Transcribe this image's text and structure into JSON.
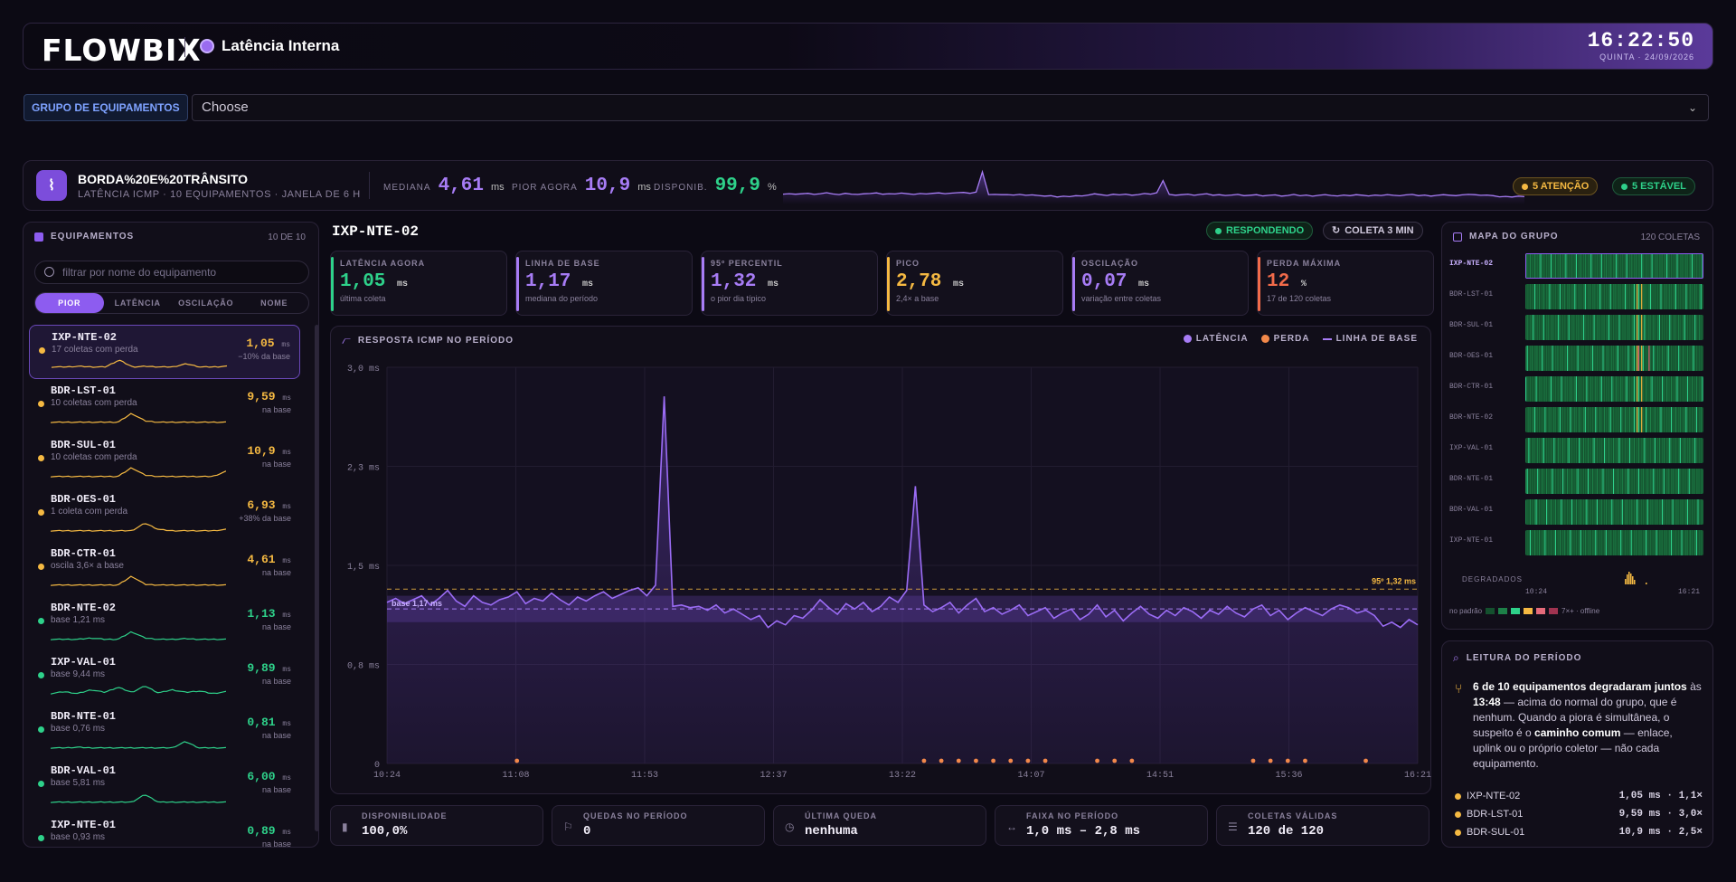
{
  "app": {
    "logo": "FLOWBIX",
    "title": "Latência Interna",
    "time": "16:22:50",
    "date": "QUINTA · 24/09/2026"
  },
  "group": {
    "label": "GRUPO DE EQUIPAMENTOS",
    "value": "Choose"
  },
  "summary": {
    "name": "BORDA%20E%20TRÂNSITO",
    "subtitle": "LATÊNCIA ICMP · 10 EQUIPAMENTOS · JANELA DE 6 H",
    "median_label": "MEDIANA",
    "median_value": "4,61",
    "median_unit": "ms",
    "worst_label": "PIOR AGORA",
    "worst_value": "10,9",
    "worst_unit": "ms",
    "avail_label": "DISPONIB.",
    "avail_value": "99,9",
    "avail_unit": "%",
    "attention_pill": "5 ATENÇÃO",
    "stable_pill": "5 ESTÁVEL"
  },
  "equipment": {
    "title": "EQUIPAMENTOS",
    "count": "10 DE 10",
    "search_placeholder": "filtrar por nome do equipamento",
    "sorts": [
      "PIOR",
      "LATÊNCIA",
      "OSCILAÇÃO",
      "NOME"
    ],
    "items": [
      {
        "name": "IXP-NTE-02",
        "sub": "17 coletas com perda",
        "value": "1,05",
        "note": "−10% da base",
        "status": "attention",
        "selected": true
      },
      {
        "name": "BDR-LST-01",
        "sub": "10 coletas com perda",
        "value": "9,59",
        "note": "na base",
        "status": "attention"
      },
      {
        "name": "BDR-SUL-01",
        "sub": "10 coletas com perda",
        "value": "10,9",
        "note": "na base",
        "status": "attention"
      },
      {
        "name": "BDR-OES-01",
        "sub": "1 coleta com perda",
        "value": "6,93",
        "note": "+38% da base",
        "status": "attention"
      },
      {
        "name": "BDR-CTR-01",
        "sub": "oscila 3,6× a base",
        "value": "4,61",
        "note": "na base",
        "status": "attention"
      },
      {
        "name": "BDR-NTE-02",
        "sub": "base 1,21 ms",
        "value": "1,13",
        "note": "na base",
        "status": "stable"
      },
      {
        "name": "IXP-VAL-01",
        "sub": "base 9,44 ms",
        "value": "9,89",
        "note": "na base",
        "status": "stable"
      },
      {
        "name": "BDR-NTE-01",
        "sub": "base 0,76 ms",
        "value": "0,81",
        "note": "na base",
        "status": "stable"
      },
      {
        "name": "BDR-VAL-01",
        "sub": "base 5,81 ms",
        "value": "6,00",
        "note": "na base",
        "status": "stable"
      },
      {
        "name": "IXP-NTE-01",
        "sub": "base 0,93 ms",
        "value": "0,89",
        "note": "na base",
        "status": "stable"
      }
    ],
    "unit": "ms"
  },
  "device": {
    "name": "IXP-NTE-02",
    "status_badge": "RESPONDENDO",
    "interval_badge": "COLETA 3 MIN",
    "cards": [
      {
        "label": "LATÊNCIA AGORA",
        "value": "1,05",
        "unit": "ms",
        "sub": "última coleta",
        "color": "#2ed18a"
      },
      {
        "label": "LINHA DE BASE",
        "value": "1,17",
        "unit": "ms",
        "sub": "mediana do período",
        "color": "#a77cf5"
      },
      {
        "label": "95º PERCENTIL",
        "value": "1,32",
        "unit": "ms",
        "sub": "o pior dia típico",
        "color": "#a77cf5"
      },
      {
        "label": "PICO",
        "value": "2,78",
        "unit": "ms",
        "sub": "2,4× a base",
        "color": "#f5b942"
      },
      {
        "label": "OSCILAÇÃO",
        "value": "0,07",
        "unit": "ms",
        "sub": "variação entre coletas",
        "color": "#a77cf5"
      },
      {
        "label": "PERDA MÁXIMA",
        "value": "12",
        "unit": "%",
        "sub": "17 de 120 coletas",
        "color": "#f26b4a"
      }
    ]
  },
  "chart_data": {
    "type": "line",
    "title": "RESPOSTA ICMP NO PERÍODO",
    "legend": [
      "LATÊNCIA",
      "PERDA",
      "LINHA DE BASE"
    ],
    "y_ticks": [
      "3,0 ms",
      "2,3 ms",
      "1,5 ms",
      "0,8 ms",
      "0"
    ],
    "ylim": [
      0,
      3.0
    ],
    "x_ticks": [
      "10:24",
      "11:08",
      "11:53",
      "12:37",
      "13:22",
      "14:07",
      "14:51",
      "15:36",
      "16:21"
    ],
    "baseline": 1.17,
    "baseline_label": "base 1,17 ms",
    "p95": 1.32,
    "p95_label": "95º 1,32 ms",
    "series": [
      {
        "name": "LATÊNCIA",
        "values": [
          1.22,
          1.25,
          1.21,
          1.24,
          1.27,
          1.2,
          1.25,
          1.31,
          1.23,
          1.19,
          1.27,
          1.22,
          1.2,
          1.24,
          1.26,
          1.3,
          1.21,
          1.25,
          1.23,
          1.29,
          1.24,
          1.2,
          1.26,
          1.23,
          1.27,
          1.3,
          1.25,
          1.28,
          1.31,
          1.33,
          1.27,
          1.35,
          2.78,
          1.19,
          1.2,
          1.18,
          1.19,
          1.16,
          1.2,
          1.14,
          1.17,
          1.13,
          1.09,
          1.12,
          1.03,
          1.08,
          1.05,
          1.12,
          1.1,
          1.16,
          1.24,
          1.18,
          1.13,
          1.21,
          1.17,
          1.22,
          1.15,
          1.19,
          1.26,
          1.22,
          1.31,
          2.1,
          1.2,
          1.15,
          1.18,
          1.22,
          1.14,
          1.2,
          1.25,
          1.15,
          1.18,
          1.13,
          1.16,
          1.2,
          1.12,
          1.15,
          1.18,
          1.1,
          1.14,
          1.17,
          1.09,
          1.13,
          1.2,
          1.11,
          1.16,
          1.08,
          1.14,
          1.19,
          1.13,
          1.1,
          1.16,
          1.12,
          1.18,
          1.15,
          1.1,
          1.16,
          1.13,
          1.19,
          1.14,
          1.11,
          1.17,
          1.2,
          1.12,
          1.16,
          1.09,
          1.14,
          1.18,
          1.15,
          1.12,
          1.17,
          1.2,
          1.18,
          1.14,
          1.16,
          1.12,
          1.04,
          1.07,
          1.03,
          1.09,
          1.05
        ]
      }
    ],
    "loss_points": [
      15,
      62,
      64,
      66,
      68,
      70,
      72,
      74,
      76,
      82,
      84,
      86,
      100,
      102,
      104,
      106,
      113
    ]
  },
  "stats": [
    {
      "label": "DISPONIBILIDADE",
      "value": "100,0%"
    },
    {
      "label": "QUEDAS NO PERÍODO",
      "value": "0"
    },
    {
      "label": "ÚLTIMA QUEDA",
      "value": "nenhuma"
    },
    {
      "label": "FAIXA NO PERÍODO",
      "value": "1,0 ms – 2,8 ms"
    },
    {
      "label": "COLETAS VÁLIDAS",
      "value": "120 de 120"
    }
  ],
  "map": {
    "title": "MAPA DO GRUPO",
    "count": "120 COLETAS",
    "rows": [
      "IXP-NTE-02",
      "BDR-LST-01",
      "BDR-SUL-01",
      "BDR-OES-01",
      "BDR-CTR-01",
      "BDR-NTE-02",
      "IXP-VAL-01",
      "BDR-NTE-01",
      "BDR-VAL-01",
      "IXP-NTE-01"
    ],
    "degraded_label": "DEGRADADOS",
    "start": "10:24",
    "end": "16:21",
    "legend_left": "no padrão",
    "legend_right": "7×+ · offline"
  },
  "reading": {
    "title": "LEITURA DO PERÍODO",
    "p1": "6 de 10 equipamentos degradaram juntos",
    "p2": " às ",
    "p3": "13:48",
    "p4": " — acima do normal do grupo, que é nenhum. Quando a piora é simultânea, o suspeito é o ",
    "p5": "caminho comum",
    "p6": " — enlace, uplink ou o próprio coletor — não cada equipamento.",
    "items": [
      {
        "name": "IXP-NTE-02",
        "value": "1,05 ms · 1,1×"
      },
      {
        "name": "BDR-LST-01",
        "value": "9,59 ms · 3,0×"
      },
      {
        "name": "BDR-SUL-01",
        "value": "10,9 ms · 2,5×"
      }
    ]
  },
  "colors": {
    "accent": "#a77cf5",
    "attention": "#f5b942",
    "stable": "#2ed18a",
    "loss": "#f26b4a"
  }
}
